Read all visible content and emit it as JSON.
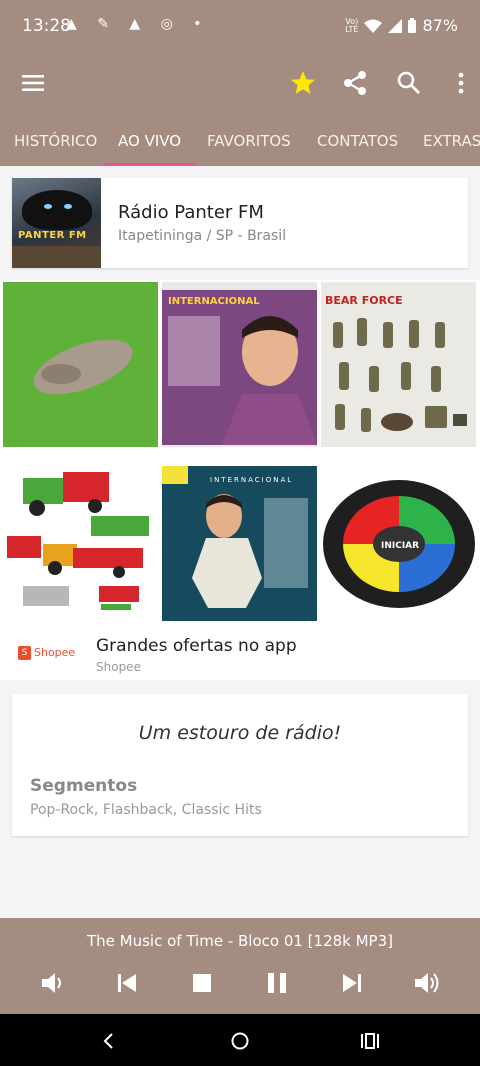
{
  "status_bar": {
    "time": "13:28",
    "network_label": "LTE",
    "battery": "87%"
  },
  "app_bar": {
    "icons": [
      "menu-icon",
      "star-icon",
      "share-icon",
      "search-icon",
      "more-vert-icon"
    ],
    "accent_color": "#a58c80",
    "star_color": "#ffe600"
  },
  "tabs": [
    {
      "label": "HISTÓRICO",
      "active": false
    },
    {
      "label": "AO VIVO",
      "active": true
    },
    {
      "label": "FAVORITOS",
      "active": false
    },
    {
      "label": "CONTATOS",
      "active": false
    },
    {
      "label": "EXTRAS",
      "active": false
    }
  ],
  "tab_indicator_color": "#e8558a",
  "station": {
    "logo_text": "PANTER FM",
    "name": "Rádio Panter FM",
    "location": "Itapetininga / SP - Brasil"
  },
  "ad": {
    "tiles": [
      {
        "caption": ""
      },
      {
        "caption": "INTERNACIONAL"
      },
      {
        "caption": "BEAR FORCE"
      },
      {
        "caption": ""
      },
      {
        "caption": "INTERNACIONAL"
      },
      {
        "caption": "INICIAR"
      }
    ],
    "advertiser_logo": "Shopee",
    "headline": "Grandes ofertas no app",
    "advertiser": "Shopee"
  },
  "info": {
    "slogan": "Um estouro de rádio!",
    "segments_title": "Segmentos",
    "segments_value": "Pop-Rock, Flashback, Classic Hits"
  },
  "player": {
    "now_playing": "The Music of Time - Bloco 01 [128k MP3]"
  }
}
